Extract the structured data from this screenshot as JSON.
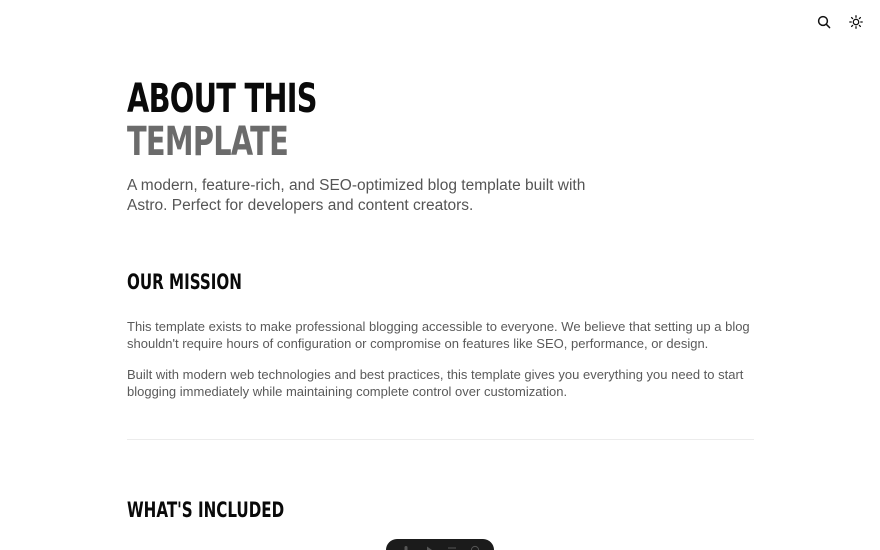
{
  "header": {
    "search_icon": "search-icon",
    "theme_icon": "sun-icon"
  },
  "hero": {
    "title_line1": "About this",
    "title_line2": "Template",
    "subtitle": "A modern, feature-rich, and SEO-optimized blog template built with Astro. Perfect for developers and content creators."
  },
  "mission": {
    "heading": "Our Mission",
    "paragraph1": "This template exists to make professional blogging accessible to everyone. We believe that setting up a blog shouldn't require hours of configuration or compromise on features like SEO, performance, or design.",
    "paragraph2": "Built with modern web technologies and best practices, this template gives you everything you need to start blogging immediately while maintaining complete control over customization."
  },
  "included": {
    "heading": "What's Included"
  },
  "dock": {
    "items": [
      "mic-icon",
      "play-icon",
      "menu-icon",
      "globe-icon"
    ]
  },
  "colors": {
    "text_primary": "#0a0a0a",
    "text_secondary": "#6b6b6b",
    "body_text": "#5a5a5a",
    "divider": "#ececec",
    "dock_bg": "#1b1b1b"
  }
}
